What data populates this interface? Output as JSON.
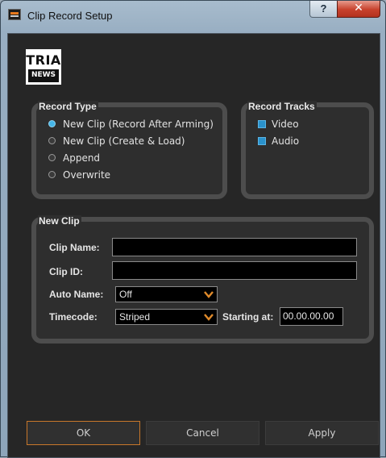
{
  "window": {
    "title": "Clip Record Setup",
    "help_label": "?",
    "close_label": "✕"
  },
  "logo": {
    "top": "TRIA",
    "bottom": "NEWS"
  },
  "record_type": {
    "title": "Record Type",
    "options": [
      {
        "label": "New Clip (Record After Arming)",
        "selected": true
      },
      {
        "label": "New Clip (Create & Load)",
        "selected": false
      },
      {
        "label": "Append",
        "selected": false
      },
      {
        "label": "Overwrite",
        "selected": false
      }
    ]
  },
  "record_tracks": {
    "title": "Record Tracks",
    "tracks": [
      {
        "label": "Video",
        "checked": true
      },
      {
        "label": "Audio",
        "checked": true
      }
    ]
  },
  "new_clip": {
    "title": "New Clip",
    "clip_name_label": "Clip Name:",
    "clip_name_value": "",
    "clip_id_label": "Clip ID:",
    "clip_id_value": "",
    "auto_name_label": "Auto Name:",
    "auto_name_value": "Off",
    "timecode_label": "Timecode:",
    "timecode_value": "Striped",
    "starting_at_label": "Starting at:",
    "starting_at_value": "00.00.00.00"
  },
  "buttons": {
    "ok": "OK",
    "cancel": "Cancel",
    "apply": "Apply"
  },
  "colors": {
    "accent": "#45b6e8",
    "checkbox": "#2a92cc",
    "dropdown_chevron": "#e08a2a",
    "ok_border": "#c8772a"
  }
}
